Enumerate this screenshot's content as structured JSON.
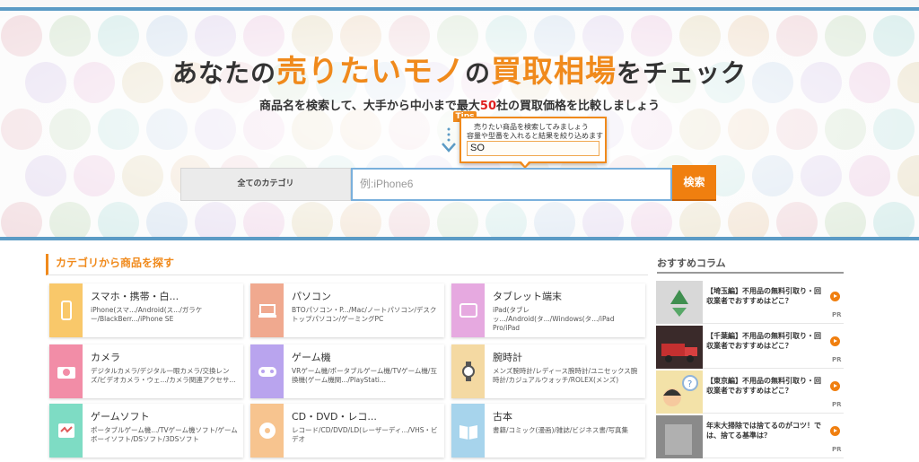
{
  "hero": {
    "title_a": "あなたの",
    "title_b": "売りたいモノ",
    "title_c": "の",
    "title_d": "買取相場",
    "title_e": "をチェック",
    "sub_a": "商品名を検索して、大手から中小まで最大",
    "sub_num": "50",
    "sub_b": "社の買取価格を比較しましょう"
  },
  "tips": {
    "label": "Tips",
    "line1": "売りたい商品を検索してみましょう",
    "line2": "容量や型番を入れると結果を絞り込めます",
    "input_value": "SO"
  },
  "search": {
    "category": "全てのカテゴリ",
    "placeholder": "例:iPhone6",
    "button": "検索"
  },
  "categories_section": {
    "title": "カテゴリから商品を探す"
  },
  "categories": [
    {
      "name": "スマホ・携帯・白...",
      "desc": "iPhone(スマ.../Android(ス.../ガラケー/BlackBerr.../iPhone SE",
      "color": "#f9c86a",
      "icon": "smartphone-icon"
    },
    {
      "name": "パソコン",
      "desc": "BTOパソコン・P.../Mac/ノートパソコン/デスクトップパソコン/ゲーミングPC",
      "color": "#f0a98f",
      "icon": "laptop-icon"
    },
    {
      "name": "タブレット端末",
      "desc": "iPad(タブレッ.../Android(タ.../Windows(タ.../iPad Pro/iPad",
      "color": "#e6a9e0",
      "icon": "tablet-icon"
    },
    {
      "name": "カメラ",
      "desc": "デジタルカメラ/デジタル一眼カメラ/交換レンズ/ビデオカメラ・ウェ.../カメラ関連アクセサ...",
      "color": "#f28da7",
      "icon": "camera-icon"
    },
    {
      "name": "ゲーム機",
      "desc": "VRゲーム機/ポータブルゲーム機/TVゲーム機/互換機(ゲーム機関.../PlayStati...",
      "color": "#b9a4ee",
      "icon": "game-console-icon"
    },
    {
      "name": "腕時計",
      "desc": "メンズ腕時計/レディース腕時計/ユニセックス腕時計/カジュアルウォッチ/ROLEX(メンズ)",
      "color": "#f4d9a2",
      "icon": "watch-icon"
    },
    {
      "name": "ゲームソフト",
      "desc": "ポータブルゲーム機.../TVゲーム機ソフト/ゲームボーイソフト/DSソフト/3DSソフト",
      "color": "#7edcc4",
      "icon": "game-soft-icon"
    },
    {
      "name": "CD・DVD・レコ...",
      "desc": "レコード/CD/DVD/LD(レーザーディ.../VHS・ビデオ",
      "color": "#f7c48f",
      "icon": "disc-icon"
    },
    {
      "name": "古本",
      "desc": "書籍/コミック(漫画)/雑誌/ビジネス書/写真集",
      "color": "#a7d4ec",
      "icon": "book-icon"
    }
  ],
  "column": {
    "title": "おすすめコラム",
    "items": [
      {
        "text": "【埼玉編】不用品の無料引取り・回収業者でおすすめはどこ？",
        "pr": "PR",
        "thumb": "recycle-icon"
      },
      {
        "text": "【千葉編】不用品の無料引取り・回収業者でおすすめはどこ？",
        "pr": "PR",
        "thumb": "truck-icon"
      },
      {
        "text": "【東京編】不用品の無料引取り・回収業者でおすすめはどこ？",
        "pr": "PR",
        "thumb": "thinking-person-icon"
      },
      {
        "text": "年末大掃除では捨てるのがコツ！では、捨てる基準は？",
        "pr": "PR",
        "thumb": "cleaning-icon"
      }
    ]
  }
}
